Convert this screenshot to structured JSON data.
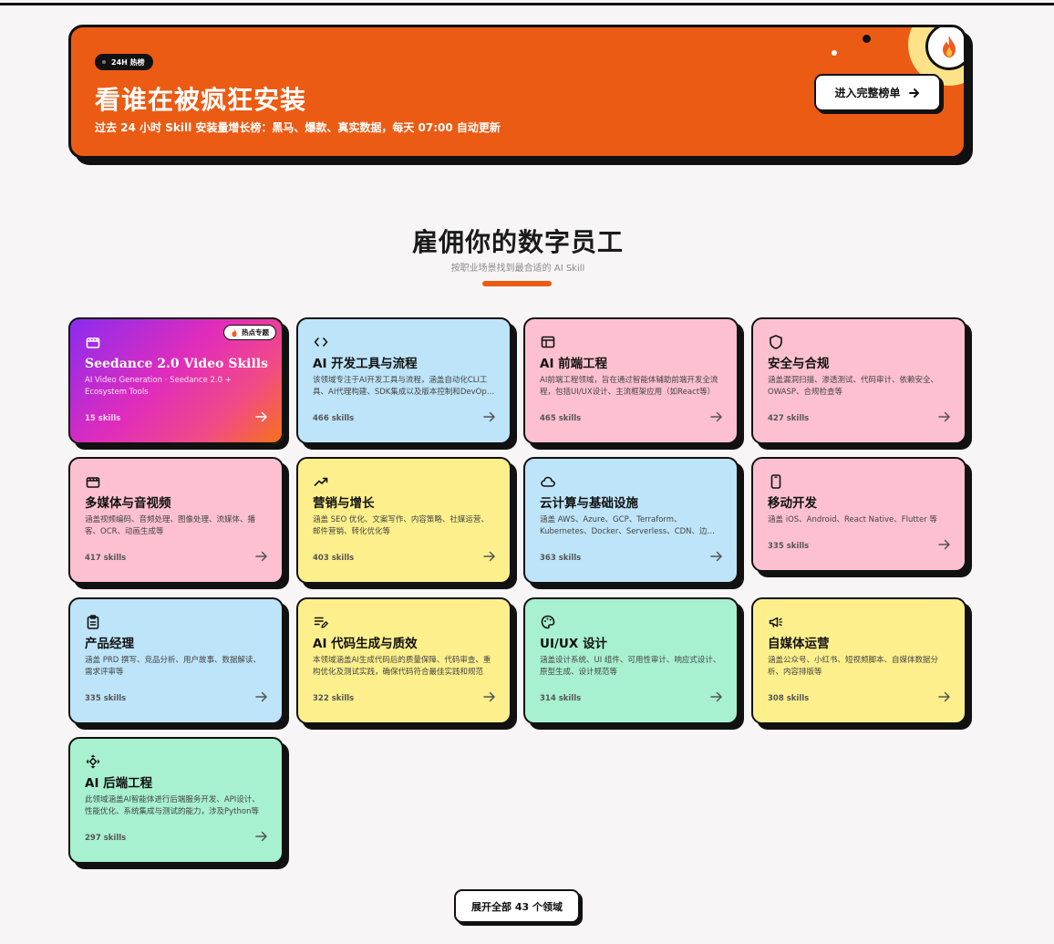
{
  "hero": {
    "badge": "24H 热榜",
    "title": "看谁在被疯狂安装",
    "subtitle": "过去 24 小时 Skill 安装量增长榜：黑马、爆款、真实数据，每天 07:00 自动更新",
    "cta_label": "进入完整榜单",
    "fire_icon": "fire-icon",
    "accent": "#ec5b14"
  },
  "section": {
    "title": "雇佣你的数字员工",
    "subtitle": "按职业场景找到最合适的 AI Skill"
  },
  "cards": [
    {
      "title": "Seedance 2.0 Video Skills",
      "desc": "AI Video Generation · Seedance 2.0 + Ecosystem Tools",
      "count": "15 skills",
      "tag": "热点专题",
      "icon": "clapperboard-icon",
      "color": "gradient"
    },
    {
      "title": "AI 开发工具与流程",
      "desc": "该领域专注于AI开发工具与流程，涵盖自动化CLI工具、AI代理构建、SDK集成以及版本控制和DevOps等",
      "count": "466 skills",
      "icon": "code-icon",
      "color": "#bde4f8"
    },
    {
      "title": "AI 前端工程",
      "desc": "AI前端工程领域，旨在通过智能体辅助前端开发全流程，包括UI/UX设计、主流框架应用（如React等）",
      "count": "465 skills",
      "icon": "browser-window-icon",
      "color": "#fcc0d0"
    },
    {
      "title": "安全与合规",
      "desc": "涵盖漏洞扫描、渗透测试、代码审计、依赖安全、OWASP、合规检查等",
      "count": "427 skills",
      "icon": "shield-icon",
      "color": "#fcc0d0"
    },
    {
      "title": "多媒体与音视频",
      "desc": "涵盖视频编码、音频处理、图像处理、流媒体、播客、OCR、动画生成等",
      "count": "417 skills",
      "icon": "clapperboard-icon",
      "color": "#fcc0d0"
    },
    {
      "title": "营销与增长",
      "desc": "涵盖 SEO 优化、文案写作、内容策略、社媒运营、邮件营销、转化优化等",
      "count": "403 skills",
      "icon": "trending-up-icon",
      "color": "#fdf08c"
    },
    {
      "title": "云计算与基础设施",
      "desc": "涵盖 AWS、Azure、GCP、Terraform、Kubernetes、Docker、Serverless、CDN、边缘计算等",
      "count": "363 skills",
      "icon": "cloud-icon",
      "color": "#bde4f8"
    },
    {
      "title": "移动开发",
      "desc": "涵盖 iOS、Android、React Native、Flutter 等",
      "count": "335 skills",
      "icon": "smartphone-icon",
      "color": "#fcc0d0"
    },
    {
      "title": "产品经理",
      "desc": "涵盖 PRD 撰写、竞品分析、用户故事、数据解读、需求评审等",
      "count": "335 skills",
      "icon": "clipboard-icon",
      "color": "#bde4f8"
    },
    {
      "title": "AI 代码生成与质效",
      "desc": "本领域涵盖AI生成代码后的质量保障、代码审查、重构优化及测试实践，确保代码符合最佳实践和规范",
      "count": "322 skills",
      "icon": "list-pen-icon",
      "color": "#fdf08c"
    },
    {
      "title": "UI/UX 设计",
      "desc": "涵盖设计系统、UI 组件、可用性审计、响应式设计、原型生成、设计规范等",
      "count": "314 skills",
      "icon": "palette-icon",
      "color": "#a7f0d0"
    },
    {
      "title": "自媒体运营",
      "desc": "涵盖公众号、小红书、短视频脚本、自媒体数据分析、内容排版等",
      "count": "308 skills",
      "icon": "megaphone-icon",
      "color": "#fdf08c"
    },
    {
      "title": "AI 后端工程",
      "desc": "此领域涵盖AI智能体进行后端服务开发、API设计、性能优化、系统集成与测试的能力，涉及Python等",
      "count": "297 skills",
      "icon": "move-arrows-icon",
      "color": "#a7f0d0"
    }
  ],
  "expand_label": "展开全部 43 个领域"
}
